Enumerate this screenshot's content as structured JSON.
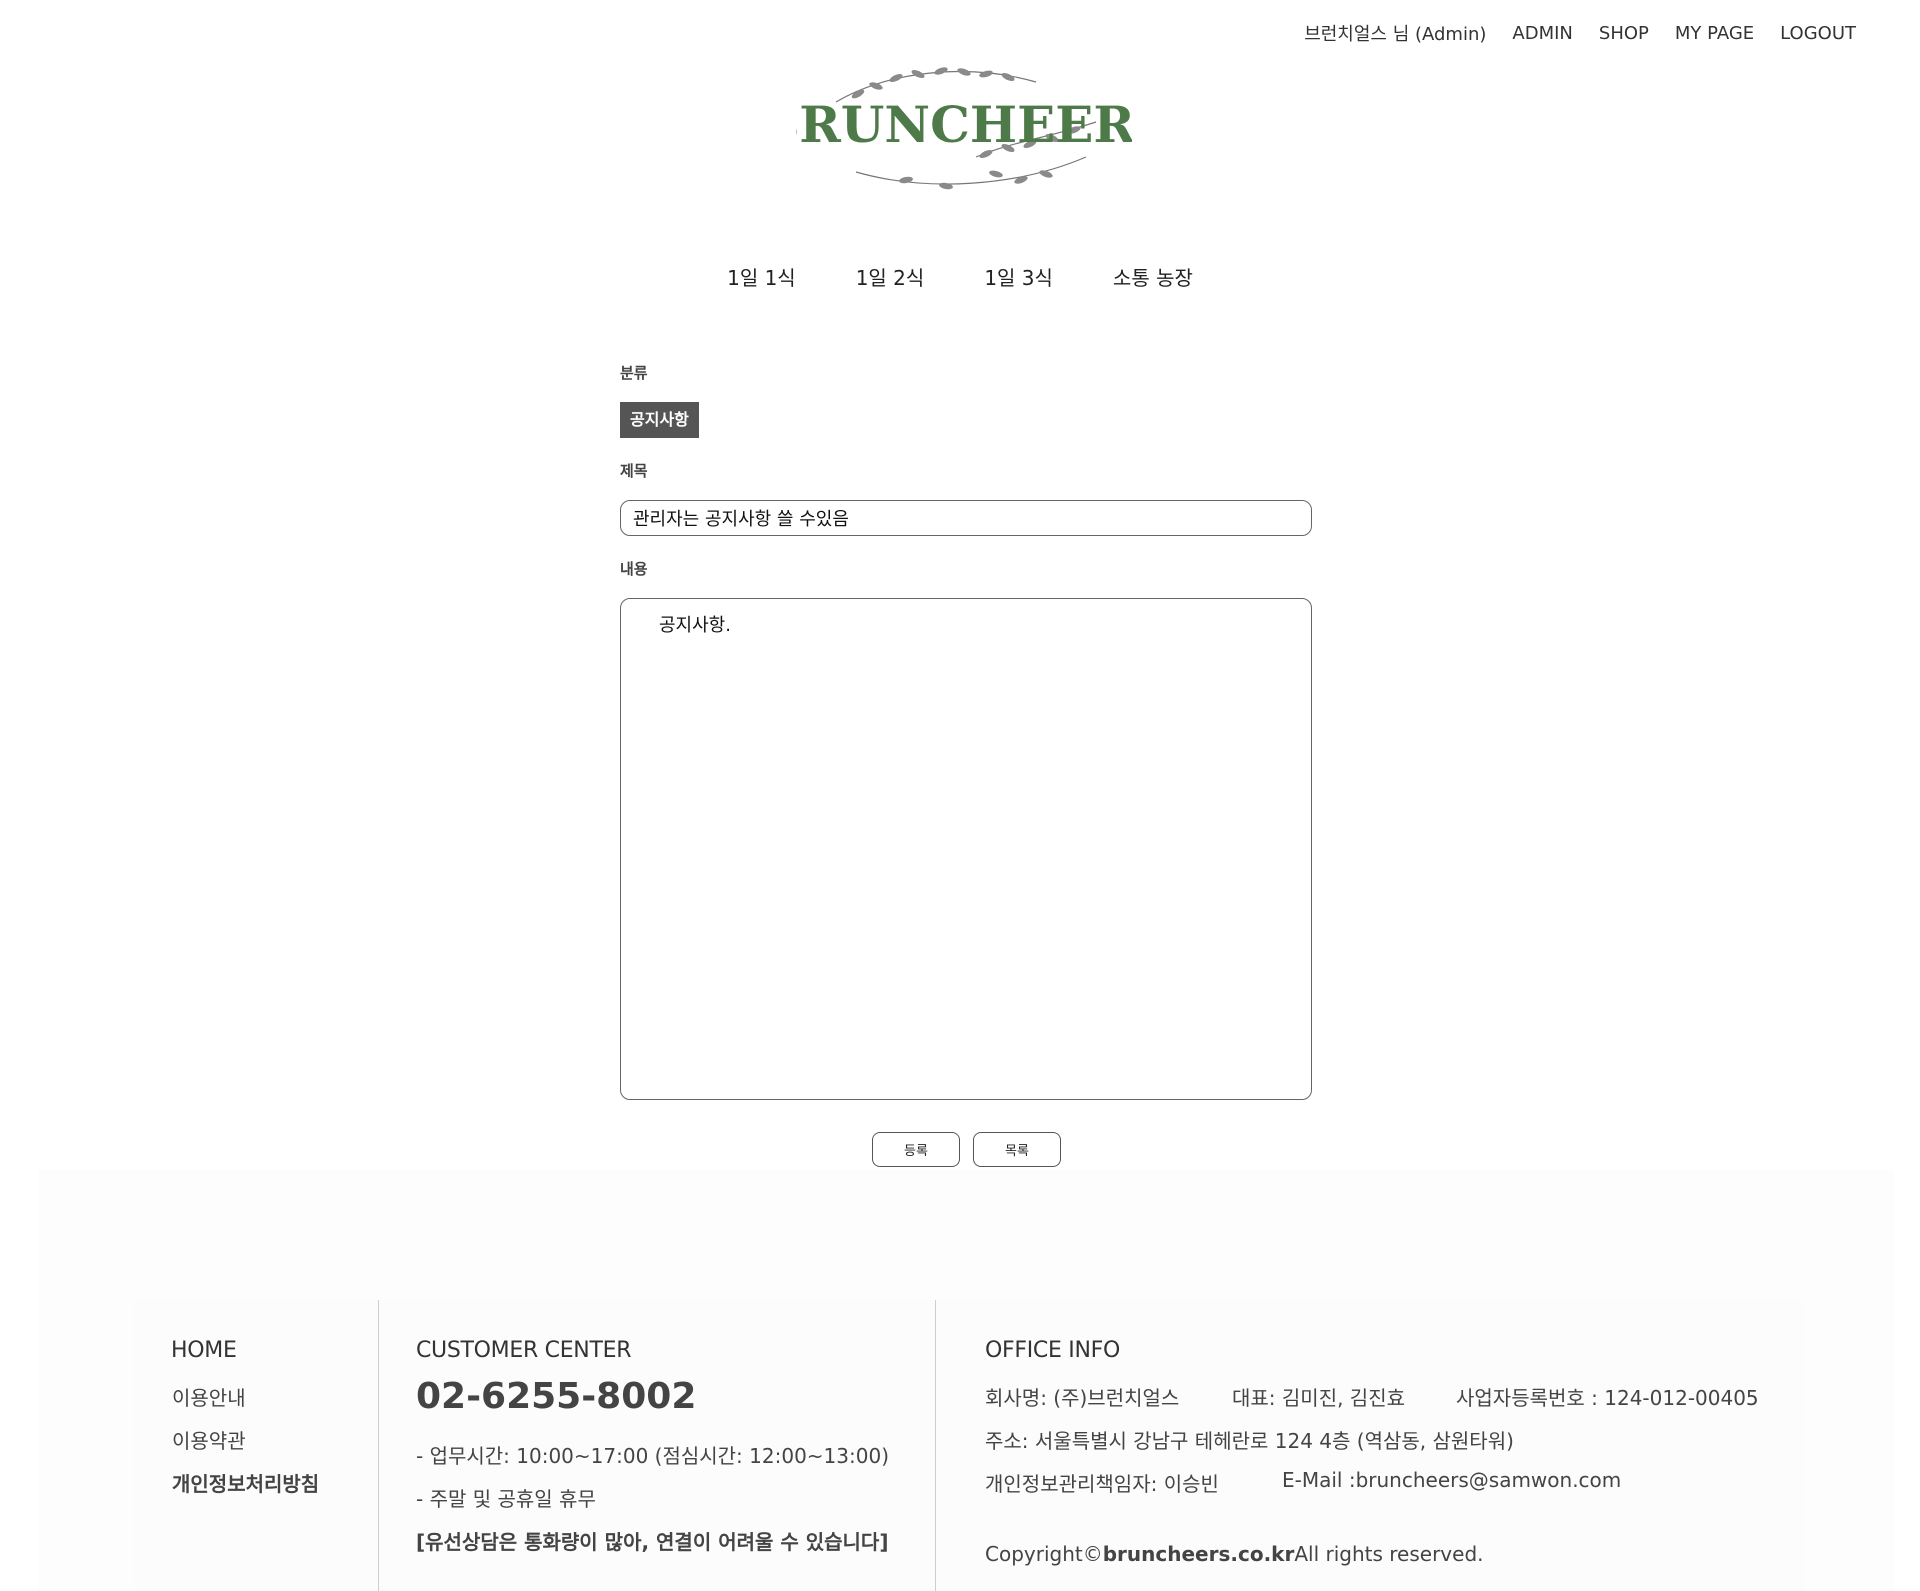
{
  "topnav": {
    "user": "브런치얼스 님 (Admin)",
    "admin": "ADMIN",
    "shop": "SHOP",
    "mypage": "MY PAGE",
    "logout": "LOGOUT"
  },
  "logo": {
    "text": "BRUNCHEERS"
  },
  "mainnav": [
    "1일 1식",
    "1일 2식",
    "1일 3식",
    "소통 농장"
  ],
  "form": {
    "category_label": "분류",
    "category_value": "공지사항",
    "title_label": "제목",
    "title_value": "관리자는 공지사항 쓸 수있음",
    "content_label": "내용",
    "content_value": "공지사항.",
    "submit_label": "등록",
    "list_label": "목록"
  },
  "footer": {
    "home": {
      "heading": "HOME",
      "links": [
        "이용안내",
        "이용약관",
        "개인정보처리방침"
      ]
    },
    "customer": {
      "heading": "CUSTOMER CENTER",
      "phone": "02-6255-8002",
      "hours": "- 업무시간: 10:00~17:00 (점심시간: 12:00~13:00)",
      "closed": "- 주말 및 공휴일 휴무",
      "notice": "[유선상담은 통화량이 많아, 연결이 어려울 수 있습니다]"
    },
    "office": {
      "heading": "OFFICE INFO",
      "company": "회사명: (주)브런치얼스",
      "ceo": "대표: 김미진, 김진효",
      "bizno": "사업자등록번호 : 124-012-00405",
      "address": "주소: 서울특별시 강남구 테헤란로 124 4층 (역삼동, 삼원타워)",
      "privacy_officer": "개인정보관리책임자: 이승빈",
      "email": "E-Mail :bruncheers@samwon.com",
      "copyright_prefix": "Copyright©",
      "copyright_domain": "bruncheers.co.kr",
      "copyright_suffix": "All rights reserved."
    }
  },
  "colors": {
    "logo_green": "#4e7a4a",
    "badge_bg": "#555555"
  }
}
